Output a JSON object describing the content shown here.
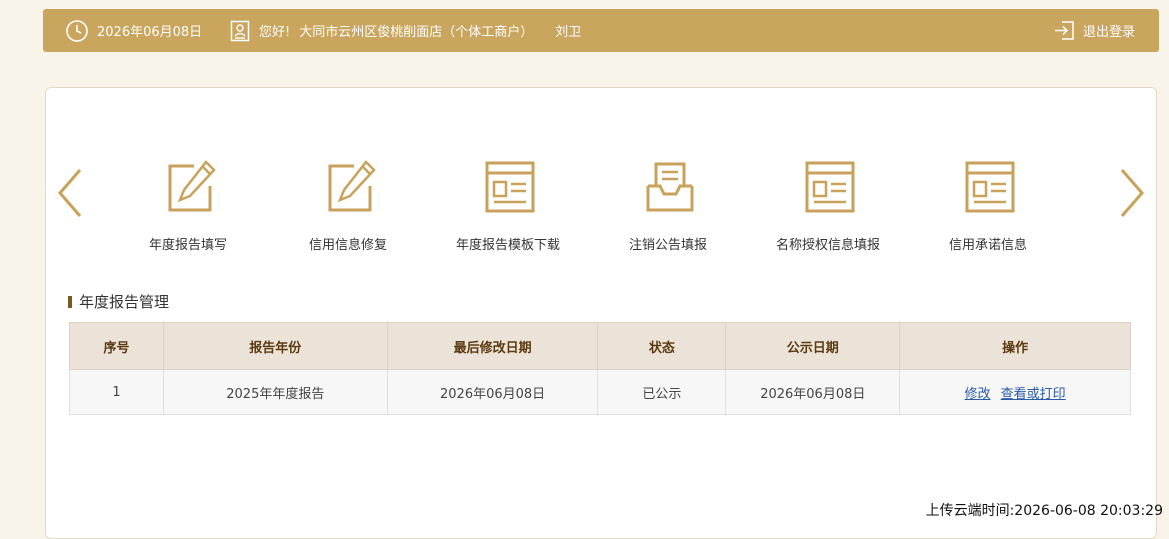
{
  "header": {
    "date": "2026年06月08日",
    "greeting": "您好!",
    "company": "大同市云州区俊桃削面店（个体工商户）",
    "user": "刘卫",
    "logout_label": "退出登录"
  },
  "menu": [
    {
      "label": "年度报告填写",
      "icon": "edit-form-icon"
    },
    {
      "label": "信用信息修复",
      "icon": "edit-form-icon"
    },
    {
      "label": "年度报告模板下载",
      "icon": "document-window-icon"
    },
    {
      "label": "注销公告填报",
      "icon": "inbox-tray-icon"
    },
    {
      "label": "名称授权信息填报",
      "icon": "document-window-icon"
    },
    {
      "label": "信用承诺信息",
      "icon": "document-window-icon"
    }
  ],
  "section_title": "年度报告管理",
  "table": {
    "headers": [
      "序号",
      "报告年份",
      "最后修改日期",
      "状态",
      "公示日期",
      "操作"
    ],
    "rows": [
      {
        "index": "1",
        "year": "2025年年度报告",
        "modified": "2026年06月08日",
        "status": "已公示",
        "published": "2026年06月08日",
        "edit_label": "修改",
        "view_label": "查看或打印"
      }
    ]
  },
  "upload_time": "上传云端时间:2026-06-08 20:03:29",
  "colors": {
    "gold": "#c9a55e",
    "icon_gold": "#c8a25a",
    "header_text": "#5b3a12",
    "link": "#2a5aa8"
  }
}
